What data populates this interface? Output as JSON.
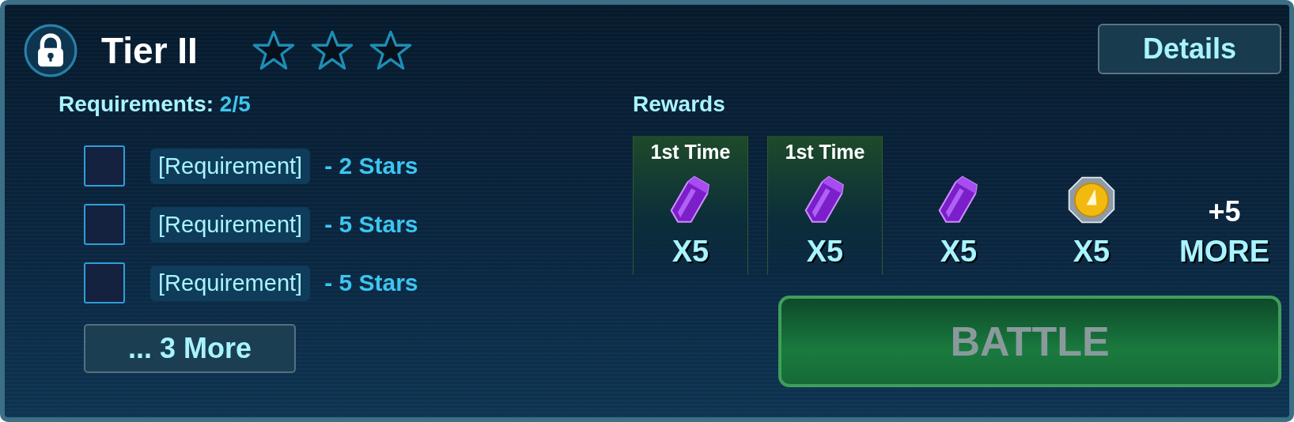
{
  "header": {
    "title": "Tier II",
    "locked": true,
    "stars": 0
  },
  "details_button": "Details",
  "requirements": {
    "label": "Requirements:",
    "progress": "2/5",
    "items": [
      {
        "name": "[Requirement]",
        "stars": "- 2 Stars",
        "checked": false
      },
      {
        "name": "[Requirement]",
        "stars": "- 5 Stars",
        "checked": false
      },
      {
        "name": "[Requirement]",
        "stars": "- 5 Stars",
        "checked": false
      }
    ],
    "more_button": "... 3 More"
  },
  "rewards": {
    "label": "Rewards",
    "items": [
      {
        "kind": "gem",
        "first_time": "1st Time",
        "count": "X5"
      },
      {
        "kind": "gem",
        "first_time": "1st Time",
        "count": "X5"
      },
      {
        "kind": "gem",
        "count": "X5"
      },
      {
        "kind": "coin",
        "count": "X5"
      },
      {
        "kind": "more",
        "extra": "+5",
        "count": "MORE"
      }
    ]
  },
  "battle_button": {
    "label": "BATTLE",
    "disabled": true
  }
}
